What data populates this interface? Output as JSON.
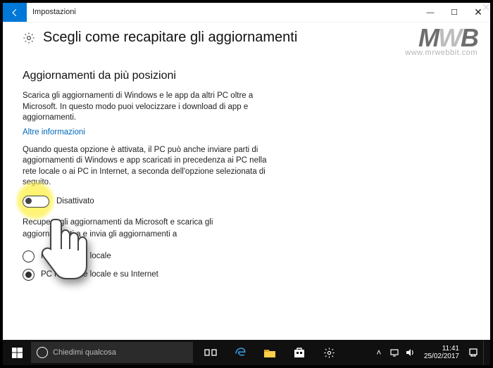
{
  "lightbox": {
    "close_glyph": "×"
  },
  "window": {
    "title": "Impostazioni",
    "controls": {
      "min_glyph": "—",
      "max_glyph": "☐",
      "close_glyph": "✕"
    }
  },
  "watermark": {
    "logo_a": "M",
    "logo_b": "W",
    "logo_c": "B",
    "url": "www.mrwebbit.com"
  },
  "page": {
    "heading": "Scegli come recapitare gli aggiornamenti",
    "section_heading": "Aggiornamenti da più posizioni",
    "intro": "Scarica gli aggiornamenti di Windows e le app da altri PC oltre a Microsoft. In questo modo puoi velocizzare i download di app e aggiornamenti.",
    "learn_more": "Altre informazioni",
    "explanation": "Quando questa opzione è attivata, il PC può anche inviare parti di aggiornamenti di Windows e app scaricati in precedenza ai PC nella rete locale o ai PC in Internet, a seconda dell'opzione selezionata di seguito.",
    "toggle": {
      "state": "off",
      "label": "Disattivato"
    },
    "below_toggle_a": "Recupera gli aggiornamenti da Microsoft e scarica gli",
    "below_toggle_b": "aggiornamenti a e invia gli aggiornamenti a",
    "radios": {
      "option1": {
        "label": "PC nella rete locale",
        "checked": false
      },
      "option2": {
        "label": "PC nella rete locale e su Internet",
        "checked": true
      }
    }
  },
  "taskbar": {
    "search_placeholder": "Chiedimi qualcosa",
    "tray": {
      "chevron": "˄"
    },
    "clock": {
      "time": "11:41",
      "date": "25/02/2017"
    }
  }
}
